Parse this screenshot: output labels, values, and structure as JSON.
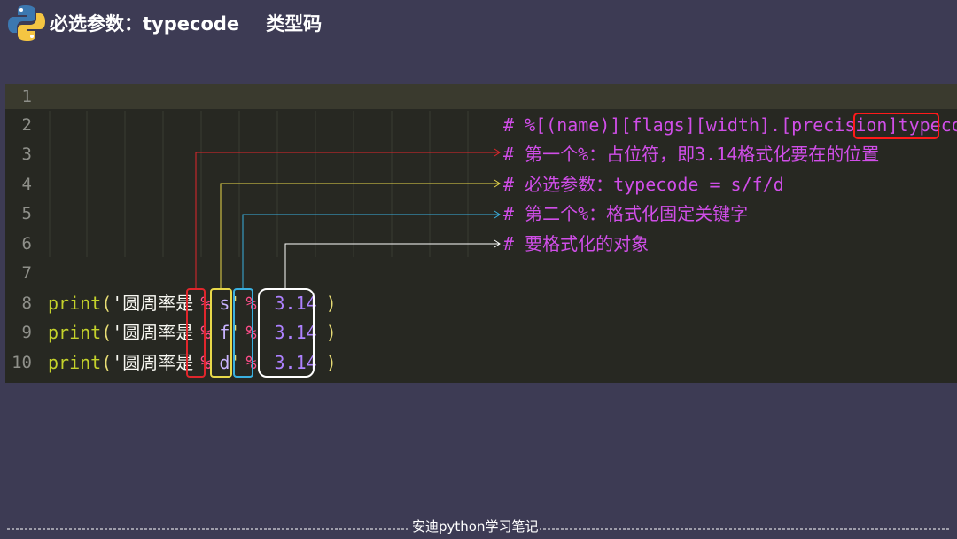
{
  "header": {
    "title": "必选参数：typecode",
    "subtitle": "类型码",
    "logo_icon": "python-logo-icon"
  },
  "editor": {
    "line_numbers": [
      "1",
      "2",
      "3",
      "4",
      "5",
      "6",
      "7",
      "8",
      "9",
      "10"
    ],
    "code": {
      "line8": {
        "fn": "print",
        "open": "(",
        "str_open": "'圆周率是",
        "pct1": "%",
        "type": "s",
        "str_close": "'",
        "pct2": "%",
        "num": "3.14",
        "close": ")"
      },
      "line9": {
        "fn": "print",
        "open": "(",
        "str_open": "'圆周率是",
        "pct1": "%",
        "type": "f",
        "str_close": "'",
        "pct2": "%",
        "num": "3.14",
        "close": ")"
      },
      "line10": {
        "fn": "print",
        "open": "(",
        "str_open": "'圆周率是",
        "pct1": "%",
        "type": "d",
        "str_close": "'",
        "pct2": "%",
        "num": "3.14",
        "close": ")"
      }
    },
    "comments": {
      "line2_prefix": "# %[(name)][flags][width].[precision]",
      "line2_highlight": "typecode",
      "line3": "# 第一个%：占位符，即3.14格式化要在的位置",
      "line4": "# 必选参数：typecode = s/f/d",
      "line5": "# 第二个%：格式化固定关键字",
      "line6": "# 要格式化的对象"
    }
  },
  "footer": {
    "text": "安迪python学习笔记"
  },
  "colors": {
    "background": "#3d3b54",
    "editor_bg": "#272822",
    "comment": "#d04ee8",
    "pct": "#ff4d8a",
    "box_red": "#e0262c",
    "box_yellow": "#e8d84a",
    "box_blue": "#3ab0e0",
    "box_white": "#ffffff",
    "typecode_box": "#ff1a1a"
  }
}
